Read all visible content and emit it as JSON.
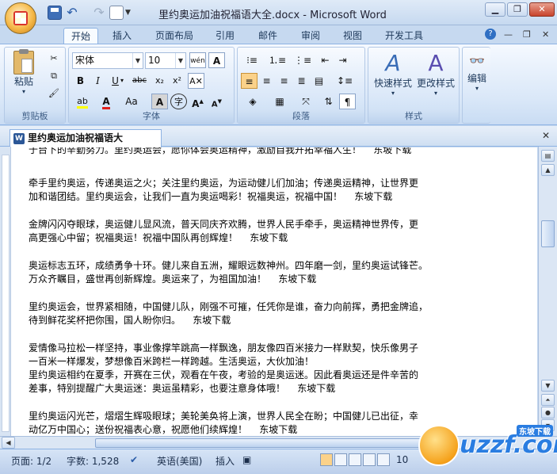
{
  "window": {
    "title": "里约奥运加油祝福语大全.docx - Microsoft Word"
  },
  "ribbon_tabs": [
    "开始",
    "插入",
    "页面布局",
    "引用",
    "邮件",
    "审阅",
    "视图",
    "开发工具"
  ],
  "clipboard": {
    "paste_label": "粘贴",
    "group": "剪贴板"
  },
  "font": {
    "name": "宋体",
    "size": "10",
    "group": "字体",
    "wen": "wén",
    "big_a": "A",
    "aa_label": "Aa"
  },
  "paragraph": {
    "group": "段落"
  },
  "styles": {
    "quick_styles": "快速样式",
    "change_styles": "更改样式",
    "group": "样式"
  },
  "editing": {
    "label": "编辑"
  },
  "document_tab": {
    "name": "里约奥运加油祝福语大全.docx"
  },
  "document": {
    "lines": [
      "于台下的辛勤努力。里约奥运会，愿你体会奥运精神，激励自我开拓幸福人生！    东坡下载",
      "牵手里约奥运，传递奥运之火；关注里约奥运，为运动健儿们加油；传递奥运精神，让世界更",
      "加和谐团结。里约奥运会，让我们一直为奥运喝彩！祝福奥运，祝福中国！    东坡下载",
      "金牌闪闪夺眼球，奥运健儿显风流，普天同庆齐欢腾，世界人民手牵手，奥运精神世界传，更",
      "高更强心中留；祝福奥运！祝福中国队再创辉煌！    东坡下载",
      "奥运标志五环，成绩勇争十环。健儿来自五洲，耀眼远数神州。四年磨一剑，里约奥运试锋芒。",
      "万众齐瞩目，盛世再创新辉煌。奥运来了，为祖国加油！    东坡下载",
      "里约奥运会，世界紧相随，中国健儿队，刚强不可摧，任凭你是谁，奋力向前挥，勇把金牌追，",
      "待到鲜花奖杯把你围，国人盼你归。    东坡下载",
      "爱情像马拉松一样坚持，事业像撑竿跳高一样飘逸，朋友像四百米接力一样默契，快乐像男子",
      "一百米一样爆发，梦想像百米跨栏一样跨越。生活奥运，大伙加油！",
      "里约奥运相约在夏季，开赛在三伏，观看在午夜，考验的是奥运迷。因此看奥运还是件辛苦的",
      "差事，特别提醒广大奥运迷：奥运虽精彩，也要注意身体哦！    东坡下载",
      "里约奥运闪光芒，熠熠生辉吸眼球；美轮美奂将上演，世界人民全在盼；中国健儿已出征，幸",
      "动亿万中国心；送份祝福表心意，祝愿他们续辉煌！    东坡下载"
    ]
  },
  "status": {
    "page": "页面: 1/2",
    "words": "字数: 1,528",
    "language": "英语(美国)",
    "insert": "插入",
    "zoom": "10"
  },
  "watermark": {
    "text": "uzzf.com",
    "sub": "东坡下载"
  }
}
